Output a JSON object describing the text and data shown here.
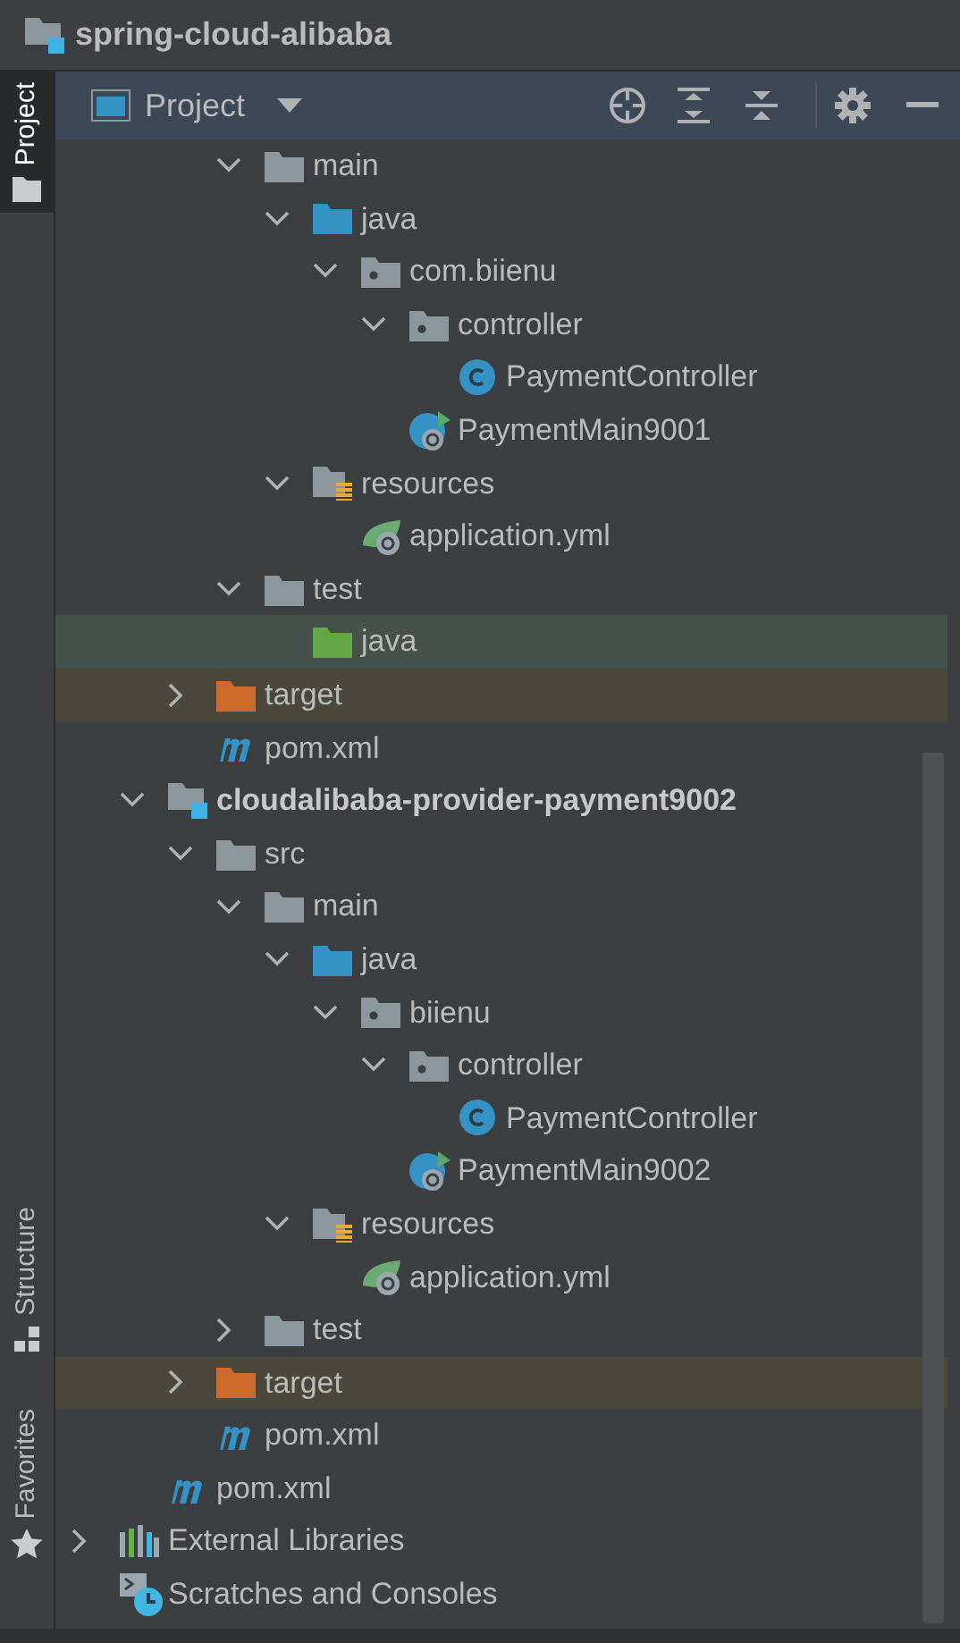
{
  "title_bar": {
    "project_name": "spring-cloud-alibaba"
  },
  "side_tabs": [
    {
      "label": "Project",
      "selected": true,
      "kind": "project"
    },
    {
      "label": "Structure",
      "selected": false,
      "kind": "structure"
    },
    {
      "label": "Favorites",
      "selected": false,
      "kind": "favorites"
    }
  ],
  "panel_header": {
    "title": "Project"
  },
  "tree": [
    {
      "children": [
        {
          "children": [
            {
              "children": [
                {
                  "label": "main",
                  "kind": "folder",
                  "expanded": true,
                  "children": [
                    {
                      "label": "java",
                      "kind": "source_folder",
                      "expanded": true,
                      "children": [
                        {
                          "label": "com.biienu",
                          "kind": "package",
                          "expanded": true,
                          "children": [
                            {
                              "label": "controller",
                              "kind": "package",
                              "expanded": true,
                              "children": [
                                {
                                  "label": "PaymentController",
                                  "kind": "class"
                                }
                              ]
                            },
                            {
                              "label": "PaymentMain9001",
                              "kind": "spring_class"
                            }
                          ]
                        }
                      ]
                    },
                    {
                      "label": "resources",
                      "kind": "resources_folder",
                      "expanded": true,
                      "children": [
                        {
                          "label": "application.yml",
                          "kind": "spring_config"
                        }
                      ]
                    }
                  ]
                },
                {
                  "label": "test",
                  "kind": "folder",
                  "expanded": true,
                  "children": [
                    {
                      "label": "java",
                      "kind": "test_folder",
                      "color": "#45514a"
                    }
                  ]
                }
              ]
            },
            {
              "label": "target",
              "kind": "excluded_folder",
              "expanded": false,
              "color": "#4c473b"
            },
            {
              "label": "pom.xml",
              "kind": "maven"
            }
          ]
        },
        {
          "label": "cloudalibaba-provider-payment9002",
          "kind": "module",
          "expanded": true,
          "children": [
            {
              "label": "src",
              "kind": "folder",
              "expanded": true,
              "children": [
                {
                  "label": "main",
                  "kind": "folder",
                  "expanded": true,
                  "children": [
                    {
                      "label": "java",
                      "kind": "source_folder",
                      "expanded": true,
                      "children": [
                        {
                          "label": "biienu",
                          "kind": "package",
                          "expanded": true,
                          "children": [
                            {
                              "label": "controller",
                              "kind": "package",
                              "expanded": true,
                              "children": [
                                {
                                  "label": "PaymentController",
                                  "kind": "class"
                                }
                              ]
                            },
                            {
                              "label": "PaymentMain9002",
                              "kind": "spring_class"
                            }
                          ]
                        }
                      ]
                    },
                    {
                      "label": "resources",
                      "kind": "resources_folder",
                      "expanded": true,
                      "children": [
                        {
                          "label": "application.yml",
                          "kind": "spring_config"
                        }
                      ]
                    }
                  ]
                },
                {
                  "label": "test",
                  "kind": "folder",
                  "expanded": false
                }
              ]
            },
            {
              "label": "target",
              "kind": "excluded_folder",
              "expanded": false,
              "color": "#4c473b"
            },
            {
              "label": "pom.xml",
              "kind": "maven"
            }
          ]
        },
        {
          "label": "pom.xml",
          "kind": "maven"
        }
      ]
    },
    {
      "label": "External Libraries",
      "kind": "libraries",
      "expanded": false
    },
    {
      "label": "Scratches and Consoles",
      "kind": "scratches"
    }
  ]
}
